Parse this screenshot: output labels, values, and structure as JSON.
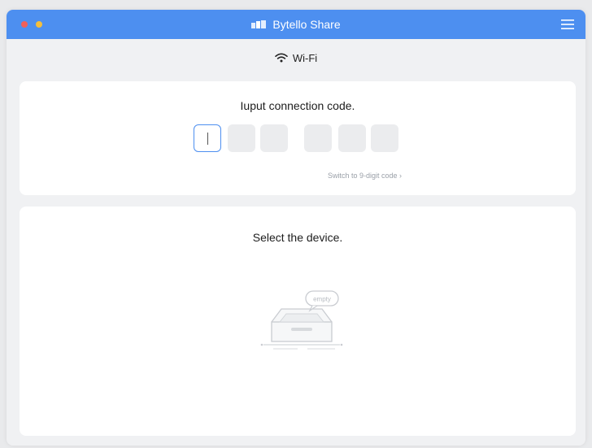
{
  "window": {
    "title": "Bytello Share",
    "accent_color": "#4d8ff0"
  },
  "network": {
    "icon": "wifi-icon",
    "label": "Wi-Fi"
  },
  "code_section": {
    "heading": "Iuput connection code.",
    "box_count": 6,
    "active_index": 0,
    "switch_link": "Switch to 9-digit code ›"
  },
  "device_section": {
    "heading": "Select the device.",
    "empty_badge": "empty"
  }
}
